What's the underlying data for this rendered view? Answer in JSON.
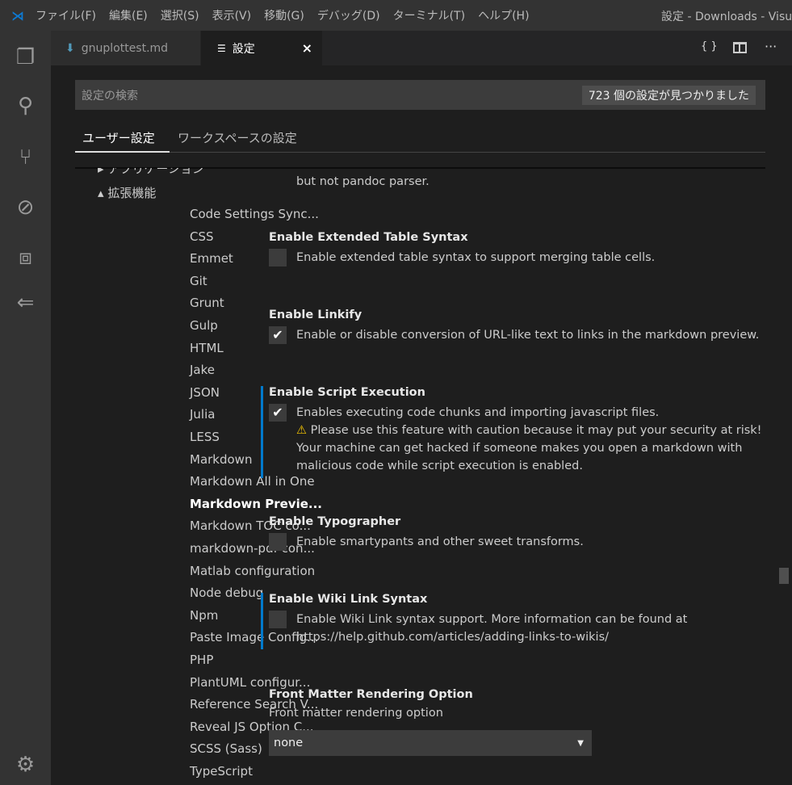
{
  "titlebar": {
    "menus": [
      "ファイル(F)",
      "編集(E)",
      "選択(S)",
      "表示(V)",
      "移動(G)",
      "デバッグ(D)",
      "ターミナル(T)",
      "ヘルプ(H)"
    ],
    "title": "設定 - Downloads - Visua"
  },
  "tabs": [
    {
      "label": "gnuplottest.md"
    },
    {
      "label": "設定",
      "close": "×"
    }
  ],
  "actions": {
    "json": "{ }",
    "more": "···"
  },
  "search": {
    "placeholder": "設定の検索",
    "count": "723 個の設定が見つかりました"
  },
  "settings_tabs": [
    "ユーザー設定",
    "ワークスペースの設定"
  ],
  "tree": {
    "partial": "アプリケーション",
    "section": "拡張機能",
    "items": [
      "Code Settings Sync...",
      "CSS",
      "Emmet",
      "Git",
      "Grunt",
      "Gulp",
      "HTML",
      "Jake",
      "JSON",
      "Julia",
      "LESS",
      "Markdown",
      "Markdown All in One",
      "Markdown Previe...",
      "Markdown TOC co...",
      "markdown-pdf con...",
      "Matlab configuration",
      "Node debug",
      "Npm",
      "Paste Image Config...",
      "PHP",
      "PlantUML configur...",
      "Reference Search V...",
      "Reveal JS Option C...",
      "SCSS (Sass)",
      "TypeScript"
    ],
    "selected": "Markdown Previe..."
  },
  "settings": {
    "prev_tail": "but not pandoc parser.",
    "ext_table": {
      "title": "Enable Extended Table Syntax",
      "desc": "Enable extended table syntax to support merging table cells.",
      "checked": false
    },
    "linkify": {
      "title": "Enable Linkify",
      "desc": "Enable or disable conversion of URL-like text to links in the markdown preview.",
      "checked": true
    },
    "script": {
      "title": "Enable Script Execution",
      "desc": "Enables executing code chunks and importing javascript files.",
      "warning": "Please use this feature with caution because it may put your security at risk! Your machine can get hacked if someone makes you open a markdown with malicious code while script execution is enabled.",
      "checked": true
    },
    "typographer": {
      "title": "Enable Typographer",
      "desc": "Enable smartypants and other sweet transforms.",
      "checked": false
    },
    "wiki": {
      "title": "Enable Wiki Link Syntax",
      "desc": "Enable Wiki Link syntax support. More information can be found at https://help.github.com/articles/adding-links-to-wikis/",
      "checked": false
    },
    "front": {
      "title": "Front Matter Rendering Option",
      "desc": "Front matter rendering option",
      "value": "none"
    }
  }
}
